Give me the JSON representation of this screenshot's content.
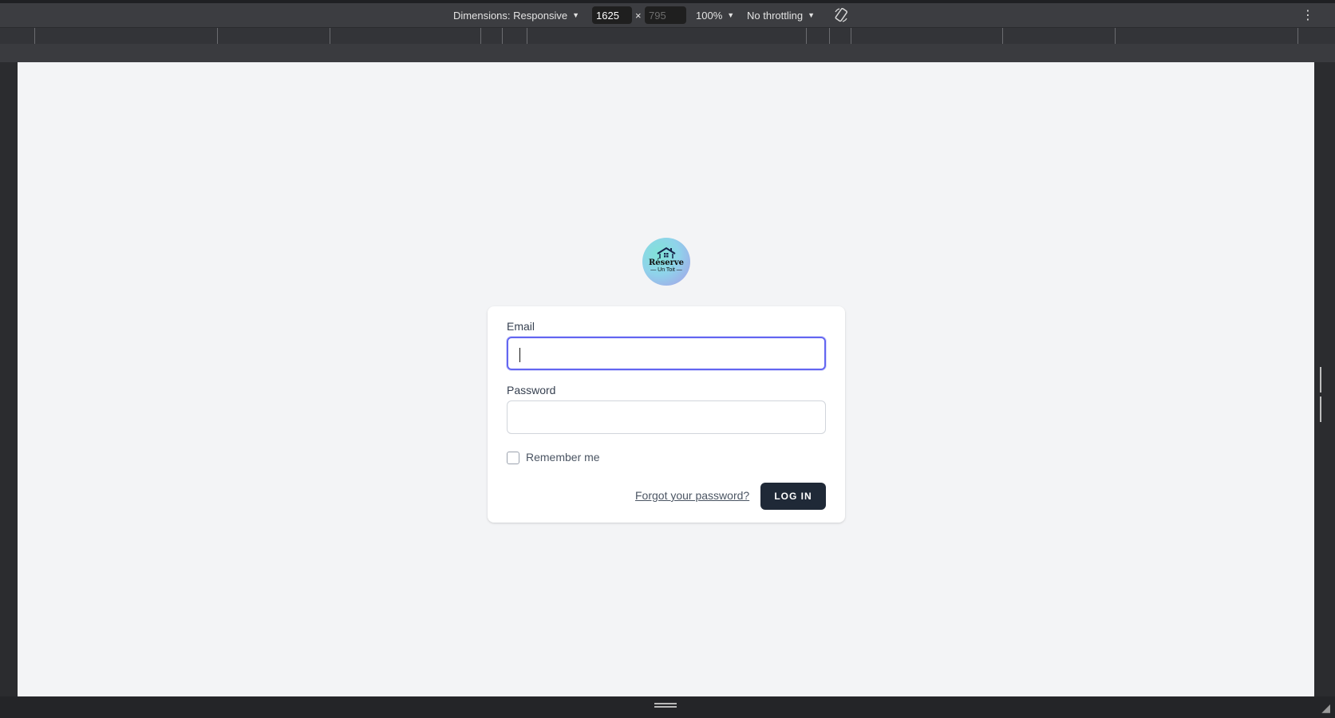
{
  "devtools": {
    "dimensions_label": "Dimensions: Responsive",
    "width_value": "1625",
    "height_placeholder": "795",
    "times_symbol": "×",
    "zoom": "100%",
    "throttling": "No throttling",
    "more_menu_symbol": "⋮",
    "resize_corner_symbol": "◢"
  },
  "logo": {
    "text": "Réserve",
    "subtext": "— Un Toit —"
  },
  "login_form": {
    "email_label": "Email",
    "email_value": "",
    "password_label": "Password",
    "password_value": "",
    "remember_label": "Remember me",
    "remember_checked": false,
    "forgot_link": "Forgot your password?",
    "submit_label": "LOG IN"
  },
  "colors": {
    "page_background": "#f3f4f6",
    "focus_ring": "#6366f1",
    "button_background": "#1f2937"
  }
}
